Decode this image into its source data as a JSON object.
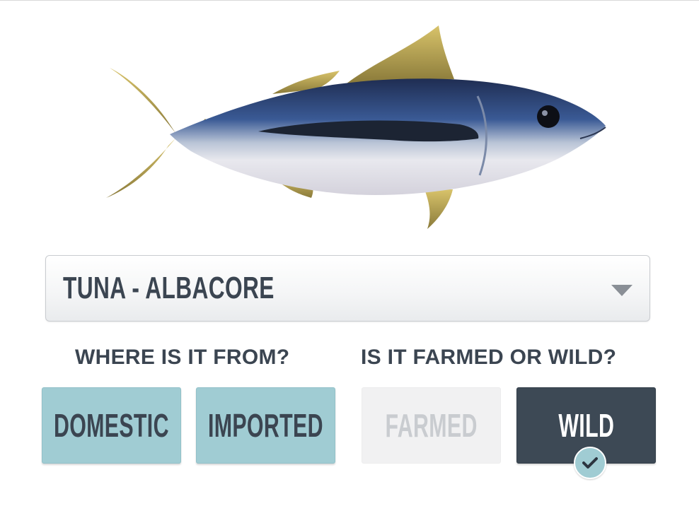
{
  "species_image": {
    "subject": "albacore-tuna"
  },
  "species_select": {
    "value": "TUNA - ALBACORE"
  },
  "questions": {
    "origin": "WHERE IS IT FROM?",
    "method": "IS IT FARMED OR WILD?"
  },
  "origin_options": [
    {
      "label": "DOMESTIC"
    },
    {
      "label": "IMPORTED"
    }
  ],
  "method_options": [
    {
      "label": "FARMED",
      "selected": false
    },
    {
      "label": "WILD",
      "selected": true
    }
  ],
  "colors": {
    "text_dark": "#3b4551",
    "teal": "#a0ccd3",
    "selected": "#3d4955",
    "unselected": "#f1f1f2"
  },
  "icons": {
    "caret": "chevron-down-icon",
    "check": "checkmark-icon"
  }
}
